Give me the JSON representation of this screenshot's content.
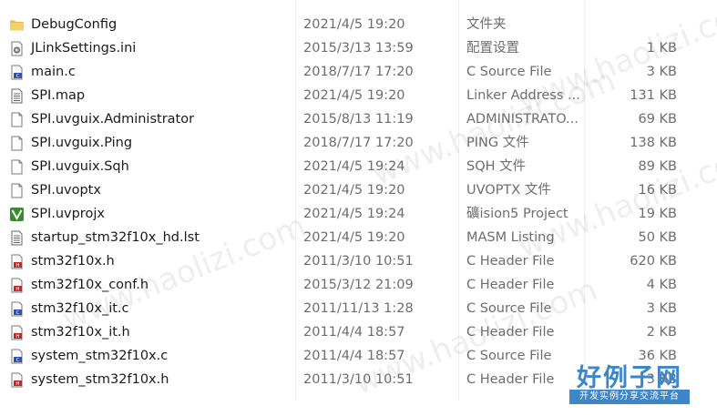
{
  "files": [
    {
      "name": "DebugConfig",
      "date": "2021/4/5 19:20",
      "type": "文件夹",
      "size": "",
      "icon": "folder-icon"
    },
    {
      "name": "JLinkSettings.ini",
      "date": "2015/3/13 13:59",
      "type": "配置设置",
      "size": "1 KB",
      "icon": "settings-file-icon"
    },
    {
      "name": "main.c",
      "date": "2018/7/17 17:20",
      "type": "C Source File",
      "size": "3 KB",
      "icon": "c-source-icon"
    },
    {
      "name": "SPI.map",
      "date": "2021/4/5 19:20",
      "type": "Linker Address ...",
      "size": "131 KB",
      "icon": "text-file-icon"
    },
    {
      "name": "SPI.uvguix.Administrator",
      "date": "2015/8/13 11:19",
      "type": "ADMINISTRATO...",
      "size": "69 KB",
      "icon": "blank-file-icon"
    },
    {
      "name": "SPI.uvguix.Ping",
      "date": "2018/7/17 17:20",
      "type": "PING 文件",
      "size": "138 KB",
      "icon": "blank-file-icon"
    },
    {
      "name": "SPI.uvguix.Sqh",
      "date": "2021/4/5 19:24",
      "type": "SQH 文件",
      "size": "89 KB",
      "icon": "blank-file-icon"
    },
    {
      "name": "SPI.uvoptx",
      "date": "2021/4/5 19:20",
      "type": "UVOPTX 文件",
      "size": "16 KB",
      "icon": "blank-file-icon"
    },
    {
      "name": "SPI.uvprojx",
      "date": "2021/4/5 19:24",
      "type": "礦ision5 Project",
      "size": "19 KB",
      "icon": "keil-project-icon"
    },
    {
      "name": "startup_stm32f10x_hd.lst",
      "date": "2021/4/5 19:20",
      "type": "MASM Listing",
      "size": "50 KB",
      "icon": "text-file-icon"
    },
    {
      "name": "stm32f10x.h",
      "date": "2011/3/10 10:51",
      "type": "C Header File",
      "size": "620 KB",
      "icon": "c-header-icon"
    },
    {
      "name": "stm32f10x_conf.h",
      "date": "2015/3/12 21:09",
      "type": "C Header File",
      "size": "4 KB",
      "icon": "c-header-icon"
    },
    {
      "name": "stm32f10x_it.c",
      "date": "2011/11/13 1:28",
      "type": "C Source File",
      "size": "3 KB",
      "icon": "c-source-icon"
    },
    {
      "name": "stm32f10x_it.h",
      "date": "2011/4/4 18:57",
      "type": "C Header File",
      "size": "2 KB",
      "icon": "c-header-icon"
    },
    {
      "name": "system_stm32f10x.c",
      "date": "2011/4/4 18:57",
      "type": "C Source File",
      "size": "36 KB",
      "icon": "c-source-icon"
    },
    {
      "name": "system_stm32f10x.h",
      "date": "2011/3/10 10:51",
      "type": "C Header File",
      "size": "3 KB",
      "icon": "c-header-icon"
    }
  ],
  "watermark": {
    "text": "www.haolizi.com"
  },
  "logo": {
    "main": "好例子网",
    "tagline": "开发实例分享交流平台"
  },
  "colors": {
    "folder": "#e9b949",
    "c_header": "#cc2222",
    "c_source": "#2c4fb0",
    "keil": "#3a8a2e",
    "logo": "#3f86c9"
  }
}
